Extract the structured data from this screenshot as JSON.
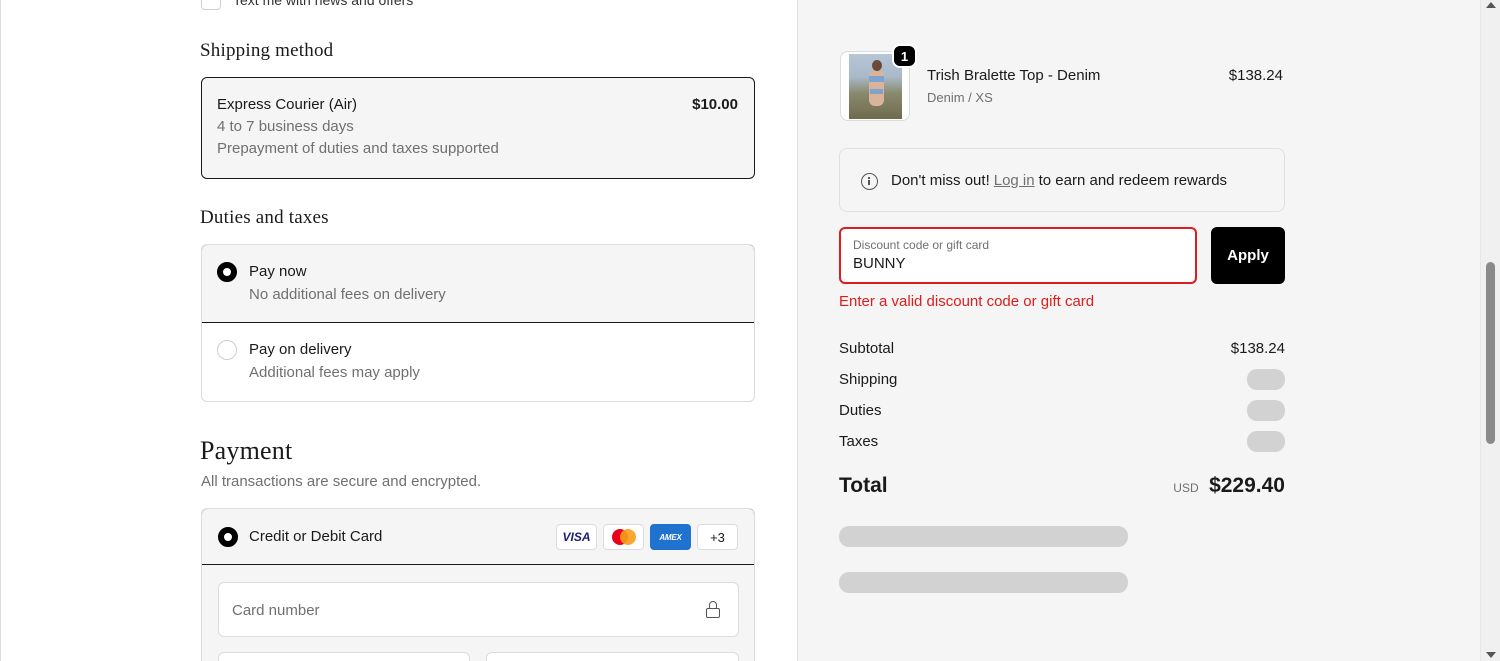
{
  "left": {
    "newsletter_label": "Text me with news and offers",
    "shipping_title": "Shipping method",
    "shipping_option": {
      "name": "Express Courier (Air)",
      "price": "$10.00",
      "line1": "4 to 7 business days",
      "line2": "Prepayment of duties and taxes supported"
    },
    "duties_title": "Duties and taxes",
    "duties_options": [
      {
        "label": "Pay now",
        "sub": "No additional fees on delivery",
        "selected": true
      },
      {
        "label": "Pay on delivery",
        "sub": "Additional fees may apply",
        "selected": false
      }
    ],
    "payment_title": "Payment",
    "payment_subtitle": "All transactions are secure and encrypted.",
    "card_option_label": "Credit or Debit Card",
    "card_brands": {
      "visa": "VISA",
      "amex": "AMEX",
      "more": "+3"
    },
    "card_number_placeholder": "Card number"
  },
  "right": {
    "product": {
      "quantity": "1",
      "name": "Trish Bralette Top - Denim",
      "variant": "Denim / XS",
      "price": "$138.24"
    },
    "rewards": {
      "prefix": "Don't miss out!",
      "link": "Log in",
      "suffix": "to earn and redeem rewards"
    },
    "discount": {
      "label": "Discount code or gift card",
      "value": "BUNNY",
      "apply_label": "Apply",
      "error": "Enter a valid discount code or gift card"
    },
    "summary": {
      "subtotal_label": "Subtotal",
      "subtotal_value": "$138.24",
      "shipping_label": "Shipping",
      "duties_label": "Duties",
      "taxes_label": "Taxes",
      "total_label": "Total",
      "total_currency": "USD",
      "total_value": "$229.40"
    }
  },
  "colors": {
    "error": "#dd1d1d",
    "accent": "#000000",
    "panel_bg": "#f5f5f5"
  }
}
